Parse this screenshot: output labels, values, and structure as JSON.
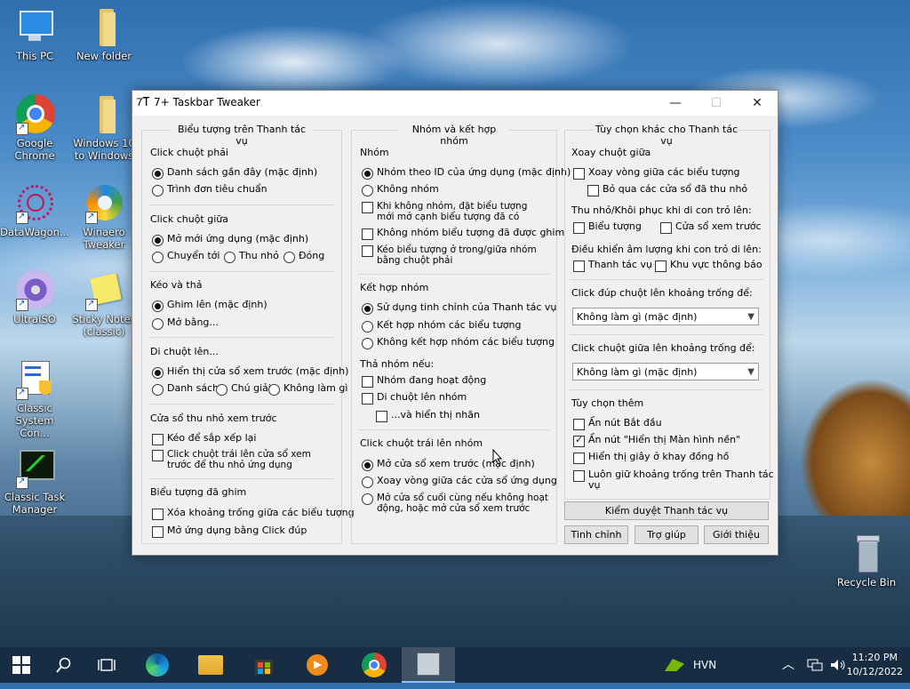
{
  "desktop": {
    "icons": [
      {
        "label": "This PC"
      },
      {
        "label": "New folder"
      },
      {
        "label": "Google Chrome"
      },
      {
        "label": "Windows 10 to Windows"
      },
      {
        "label": "DataWagon..."
      },
      {
        "label": "Winaero Tweaker"
      },
      {
        "label": "UltraISO"
      },
      {
        "label": "Sticky Notes (classic)"
      },
      {
        "label": "Classic System Con..."
      },
      {
        "label": "Classic Task Manager"
      },
      {
        "label": "Recycle Bin"
      }
    ]
  },
  "window": {
    "title": "7+ Taskbar Tweaker",
    "controls": {
      "minimize": "—",
      "maximize": "☐",
      "close": "✕"
    },
    "col1": {
      "title": "Biểu tượng trên Thanh tác vụ",
      "right_click": {
        "label": "Click chuột phải",
        "opt1": "Danh sách gần đây (mặc định)",
        "opt2": "Trình đơn tiêu chuẩn"
      },
      "middle_click": {
        "label": "Click chuột giữa",
        "opt1": "Mở mới ứng dụng (mặc định)",
        "opt2": "Chuyển tới",
        "opt3": "Thu nhỏ",
        "opt4": "Đóng"
      },
      "drag": {
        "label": "Kéo và thả",
        "opt1": "Ghim lên (mặc định)",
        "opt2": "Mở bằng..."
      },
      "hover": {
        "label": "Di chuột lên...",
        "opt1": "Hiển thị cửa sổ xem trước (mặc định)",
        "opt2": "Danh sách",
        "opt3": "Chú giải",
        "opt4": "Không làm gì"
      },
      "thumbs": {
        "label": "Cửa sổ thu nhỏ xem trước",
        "opt1": "Kéo để sắp xếp lại",
        "opt2": "Click chuột trái lên cửa sổ xem trước để thu nhỏ ứng dụng"
      },
      "pinned": {
        "label": "Biểu tượng đã ghim",
        "opt1": "Xóa khoảng trống giữa các biểu tượng",
        "opt2": "Mở ứng dụng bằng Click đúp"
      }
    },
    "col2": {
      "title": "Nhóm và kết hợp nhóm",
      "grouping": {
        "label": "Nhóm",
        "opt1": "Nhóm theo ID của ứng dụng (mặc định)",
        "opt2": "Không nhóm",
        "opt3": "Khi không nhóm, đặt biểu tượng mới mở cạnh biểu tượng đã có",
        "opt4": "Không nhóm biểu tượng đã được ghim",
        "opt5": "Kéo biểu tượng ở trong/giữa nhóm bằng chuột phải"
      },
      "combining": {
        "label": "Kết hợp nhóm",
        "opt1": "Sử dụng tinh chỉnh của Thanh tác vụ",
        "opt2": "Kết hợp nhóm các biểu tượng",
        "opt3": "Không kết hợp nhóm các biểu tượng"
      },
      "drop": {
        "label": "Thả nhóm nếu:",
        "opt1": "Nhóm đang hoạt động",
        "opt2": "Di chuột lên nhóm",
        "opt3": "...và hiển thị nhãn"
      },
      "left_click": {
        "label": "Click chuột trái lên nhóm",
        "opt1": "Mở cửa sổ xem trước (mặc định)",
        "opt2": "Xoay vòng giữa các cửa sổ ứng dụng",
        "opt3": "Mở cửa sổ cuối cùng nếu không hoạt động, hoặc mở cửa sổ xem trước"
      }
    },
    "col3": {
      "title": "Tùy chọn khác cho Thanh tác vụ",
      "wheel": {
        "label": "Xoay chuột giữa",
        "opt1": "Xoay vòng giữa các biểu tượng",
        "opt2": "Bỏ qua các cửa sổ đã thu nhỏ"
      },
      "minrestore": {
        "label": "Thu nhỏ/Khôi phục khi di con trỏ lên:",
        "opt1": "Biểu tượng",
        "opt2": "Cửa sổ xem trước"
      },
      "volume": {
        "label": "Điều khiển âm lượng khi con trỏ di lên:",
        "opt1": "Thanh tác vụ",
        "opt2": "Khu vực thông báo"
      },
      "dbl_click": {
        "label": "Click đúp chuột lên khoảng trống để:",
        "value": "Không làm gì (mặc định)"
      },
      "mid_click": {
        "label": "Click chuột giữa lên khoảng trống để:",
        "value": "Không làm gì (mặc định)"
      },
      "extra": {
        "label": "Tùy chọn thêm",
        "opt1": "Ẩn nút Bắt đầu",
        "opt2": "Ẩn nút \"Hiển thị Màn hình nền\"",
        "opt3": "Hiển thị giây ở khay đồng hồ",
        "opt4": "Luôn giữ khoảng trống trên Thanh tác vụ"
      },
      "inspector": "Kiểm duyệt Thanh tác vụ",
      "settings": "Tinh chỉnh",
      "help": "Trợ giúp",
      "about": "Giới thiệu"
    }
  },
  "taskbar": {
    "tray": {
      "nvidia": "HVN",
      "time": "11:20 PM",
      "date": "10/12/2022"
    }
  }
}
